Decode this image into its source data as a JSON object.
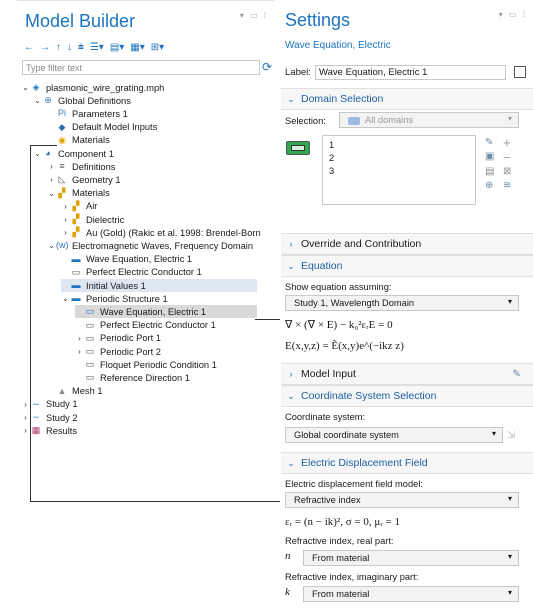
{
  "model_builder": {
    "title": "Model Builder",
    "filter_placeholder": "Type filter text",
    "toolbar": [
      "←",
      "→",
      "↑",
      "↓",
      "⩧",
      "☰▾",
      "▤▾",
      "▦▾",
      "⊞▾"
    ],
    "tree": [
      {
        "label": "plasmonic_wire_grating.mph",
        "level": 0,
        "chevron": "⌄",
        "icon": "◈",
        "color": "#1c73bf"
      },
      {
        "label": "Global Definitions",
        "level": 1,
        "chevron": "⌄",
        "icon": "⊕",
        "color": "#3d7fb8"
      },
      {
        "label": "Parameters 1",
        "level": 2,
        "chevron": "",
        "icon": "Pi",
        "color": "#3d7fb8"
      },
      {
        "label": "Default Model Inputs",
        "level": 2,
        "chevron": "",
        "icon": "◆",
        "color": "#2a6fb2"
      },
      {
        "label": "Materials",
        "level": 2,
        "chevron": "",
        "icon": "◉",
        "color": "#e0a100"
      },
      {
        "label": "Component 1",
        "level": 1,
        "chevron": "⌄",
        "icon": "◕",
        "color": "#2a6fb2"
      },
      {
        "label": "Definitions",
        "level": 2,
        "chevron": "›",
        "icon": "≡",
        "color": "#555"
      },
      {
        "label": "Geometry 1",
        "level": 2,
        "chevron": "›",
        "icon": "◺",
        "color": "#555"
      },
      {
        "label": "Materials",
        "level": 2,
        "chevron": "⌄",
        "icon": "▞",
        "color": "#e0a100"
      },
      {
        "label": "Air",
        "level": 3,
        "chevron": "›",
        "icon": "▞",
        "color": "#e0a100"
      },
      {
        "label": "Dielectric",
        "level": 3,
        "chevron": "›",
        "icon": "▞",
        "color": "#e0a100"
      },
      {
        "label": "Au (Gold) (Rakic et al. 1998: Brendel-Born",
        "level": 3,
        "chevron": "›",
        "icon": "▞",
        "color": "#e0a100"
      },
      {
        "label": "Electromagnetic Waves, Frequency Domain",
        "level": 2,
        "chevron": "⌄",
        "icon": "(w)",
        "color": "#2a6fb2"
      },
      {
        "label": "Wave Equation, Electric 1",
        "level": 3,
        "chevron": "",
        "icon": "▬",
        "color": "#1c73bf"
      },
      {
        "label": "Perfect Electric Conductor 1",
        "level": 3,
        "chevron": "",
        "icon": "▭",
        "color": "#555"
      },
      {
        "label": "Initial Values 1",
        "level": 3,
        "chevron": "",
        "icon": "▬",
        "color": "#1c73bf",
        "style": "hl"
      },
      {
        "label": "Periodic Structure 1",
        "level": 3,
        "chevron": "⌄",
        "icon": "▬",
        "color": "#1c73bf"
      },
      {
        "label": "Wave Equation, Electric 1",
        "level": 4,
        "chevron": "",
        "icon": "▭",
        "color": "#1c73bf",
        "style": "sel"
      },
      {
        "label": "Perfect Electric Conductor 1",
        "level": 4,
        "chevron": "",
        "icon": "▭",
        "color": "#555"
      },
      {
        "label": "Periodic Port 1",
        "level": 4,
        "chevron": "›",
        "icon": "▭",
        "color": "#555"
      },
      {
        "label": "Periodic Port 2",
        "level": 4,
        "chevron": "›",
        "icon": "▭",
        "color": "#555"
      },
      {
        "label": "Floquet Periodic Condition 1",
        "level": 4,
        "chevron": "",
        "icon": "▭",
        "color": "#555"
      },
      {
        "label": "Reference Direction 1",
        "level": 4,
        "chevron": "",
        "icon": "▭",
        "color": "#555"
      },
      {
        "label": "Mesh 1",
        "level": 2,
        "chevron": "",
        "icon": "▲",
        "color": "#888"
      },
      {
        "label": "Study 1",
        "level": 0,
        "chevron": "›",
        "icon": "∼",
        "color": "#1c9ab8"
      },
      {
        "label": "Study 2",
        "level": 0,
        "chevron": "›",
        "icon": "∼",
        "color": "#1c9ab8"
      },
      {
        "label": "Results",
        "level": 0,
        "chevron": "›",
        "icon": "▦",
        "color": "#b03a6a"
      }
    ]
  },
  "settings": {
    "title": "Settings",
    "subtitle": "Wave Equation, Electric",
    "label_caption": "Label:",
    "label_value": "Wave Equation, Electric 1",
    "domain_selection": {
      "header": "Domain Selection",
      "selection_caption": "Selection:",
      "selection_value": "All domains",
      "items": [
        "1",
        "2",
        "3"
      ]
    },
    "override_header": "Override and Contribution",
    "equation": {
      "header": "Equation",
      "show_caption": "Show equation assuming:",
      "study_value": "Study 1, Wavelength Domain",
      "eq1": "∇ × (∇ × E) − k₀²εᵣE = 0",
      "eq2": "E(x,y,z) = Ẽ(x,y)e^(−ikz z)"
    },
    "model_input_header": "Model Input",
    "coord_system": {
      "header": "Coordinate System Selection",
      "caption": "Coordinate system:",
      "value": "Global coordinate system"
    },
    "edf": {
      "header": "Electric Displacement Field",
      "model_caption": "Electric displacement field model:",
      "model_value": "Refractive index",
      "eq": "εᵣ = (n − ik)², σ = 0, μᵣ = 1",
      "real_caption": "Refractive index, real part:",
      "real_symbol": "n",
      "real_value": "From material",
      "imag_caption": "Refractive index, imaginary part:",
      "imag_symbol": "k",
      "imag_value": "From material"
    }
  },
  "colors": {
    "accent": "#1c73bf",
    "selected": "#d9d9d9",
    "highlight": "#dde7f2"
  }
}
